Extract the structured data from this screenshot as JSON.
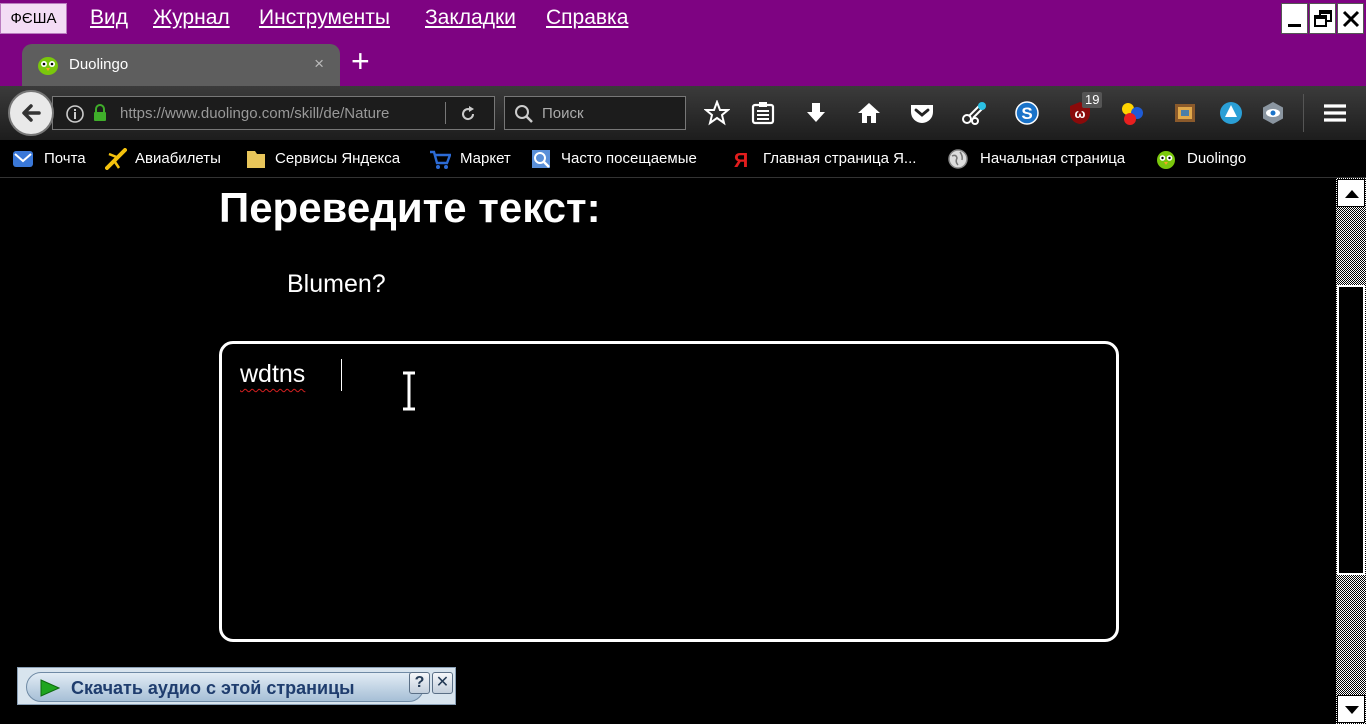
{
  "menubar": {
    "file_label": "ФЄША",
    "items": [
      "Вид",
      "Журнал",
      "Инструменты",
      "Закладки",
      "Справка"
    ]
  },
  "tab": {
    "title": "Duolingo",
    "close_glyph": "×",
    "new_tab_glyph": "+"
  },
  "navbar": {
    "url": "https://www.duolingo.com/skill/de/Nature",
    "search_placeholder": "Поиск",
    "badge_count": "19"
  },
  "bookmarks": [
    {
      "label": "Почта",
      "icon": "mail-icon"
    },
    {
      "label": "Авиабилеты",
      "icon": "plane-icon"
    },
    {
      "label": "Сервисы Яндекса",
      "icon": "folder-icon"
    },
    {
      "label": "Маркет",
      "icon": "cart-icon"
    },
    {
      "label": "Часто посещаемые",
      "icon": "frequent-icon"
    },
    {
      "label": "Главная страница Я...",
      "icon": "yandex-icon"
    },
    {
      "label": "Начальная страница",
      "icon": "globe-icon"
    },
    {
      "label": "Duolingo",
      "icon": "duolingo-owl-icon"
    }
  ],
  "content": {
    "heading": "Переведите текст:",
    "prompt": "Blumen?",
    "answer_value": "wdtns"
  },
  "audio_widget": {
    "label": "Скачать аудио с этой страницы",
    "help_glyph": "?",
    "close_glyph": "✕"
  },
  "colors": {
    "menubar_bg": "#7e0382",
    "tab_bg": "#5e5e5e",
    "content_bg": "#000000",
    "spell_error": "#d62020"
  }
}
